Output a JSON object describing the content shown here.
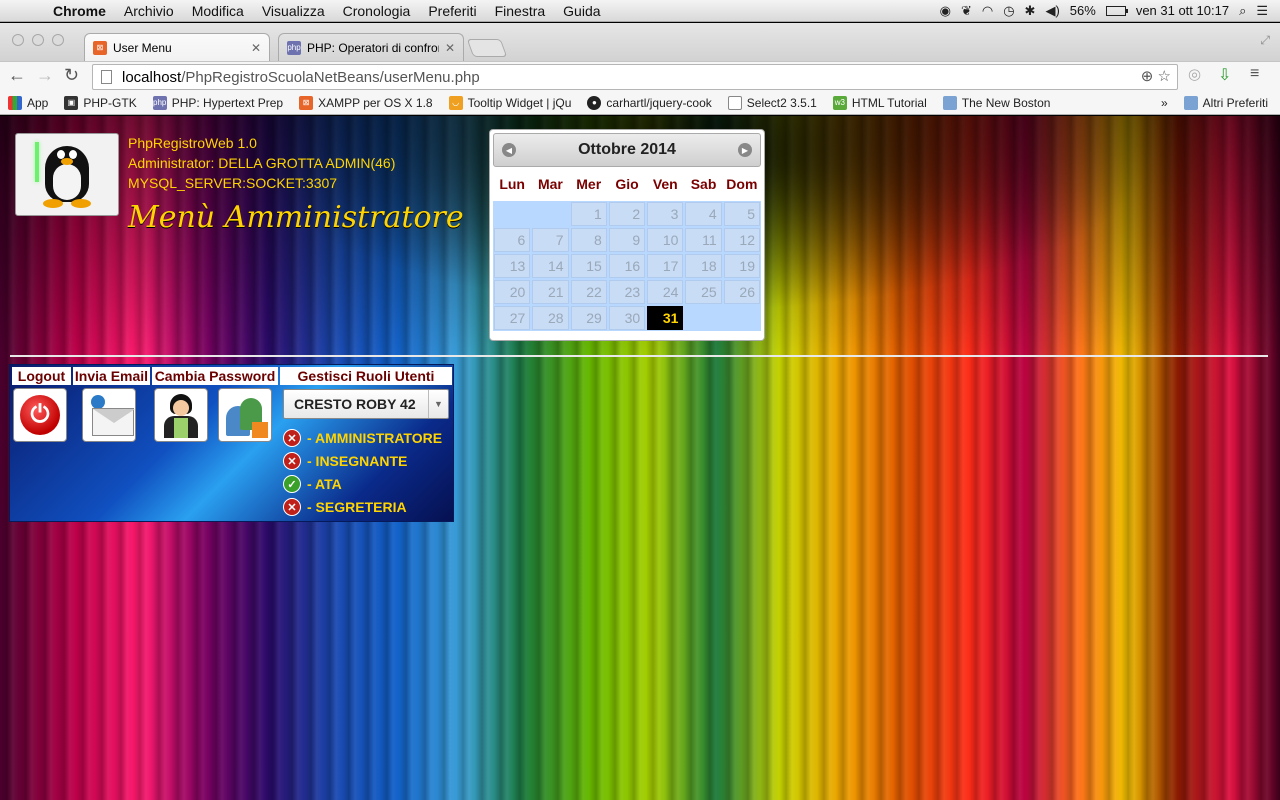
{
  "menubar": {
    "apple": "",
    "items": [
      "Chrome",
      "Archivio",
      "Modifica",
      "Visualizza",
      "Cronologia",
      "Preferiti",
      "Finestra",
      "Guida"
    ],
    "battery": "56%",
    "datetime": "ven 31 ott  10:17"
  },
  "tabs": [
    {
      "title": "User Menu",
      "favicon": "xampp-icon"
    },
    {
      "title": "PHP: Operatori di confront",
      "favicon": "php-icon"
    }
  ],
  "address": {
    "host": "localhost",
    "path": "/PhpRegistroScuolaNetBeans/userMenu.php"
  },
  "bookmarks": {
    "items": [
      {
        "label": "App",
        "icon": "apps-icon"
      },
      {
        "label": "PHP-GTK",
        "icon": "php-gtk-icon"
      },
      {
        "label": "PHP: Hypertext Prep",
        "icon": "php-icon"
      },
      {
        "label": "XAMPP per OS X 1.8",
        "icon": "xampp-icon"
      },
      {
        "label": "Tooltip Widget | jQu",
        "icon": "jquery-icon"
      },
      {
        "label": "carhartl/jquery-cook",
        "icon": "github-icon"
      },
      {
        "label": "Select2 3.5.1",
        "icon": "page-icon"
      },
      {
        "label": "HTML Tutorial",
        "icon": "w3-icon"
      },
      {
        "label": "The New Boston",
        "icon": "folder-icon"
      }
    ],
    "overflow": "»",
    "other": "Altri Preferiti"
  },
  "header": {
    "app_version": "PhpRegistroWeb 1.0",
    "administrator": "Administrator: DELLA GROTTA ADMIN(46)",
    "server": "MYSQL_SERVER:SOCKET:3307",
    "title": "Menù Amministratore"
  },
  "calendar": {
    "month_title": "Ottobre 2014",
    "weekdays": [
      "Lun",
      "Mar",
      "Mer",
      "Gio",
      "Ven",
      "Sab",
      "Dom"
    ],
    "leading_blanks": 2,
    "days_in_month": 31,
    "today": 31
  },
  "panel": {
    "tabs": {
      "logout": "Logout",
      "email": "Invia Email",
      "password": "Cambia Password",
      "roles": "Gestisci Ruoli Utenti"
    },
    "selected_user": "CRESTO ROBY 42",
    "roles": [
      {
        "label": "- AMMINISTRATORE",
        "enabled": false
      },
      {
        "label": "- INSEGNANTE",
        "enabled": false
      },
      {
        "label": "- ATA",
        "enabled": true
      },
      {
        "label": "- SEGRETERIA",
        "enabled": false
      }
    ]
  },
  "colors": {
    "accent": "#ffd400",
    "dark_red": "#7a0000",
    "today_bg": "#000000"
  }
}
